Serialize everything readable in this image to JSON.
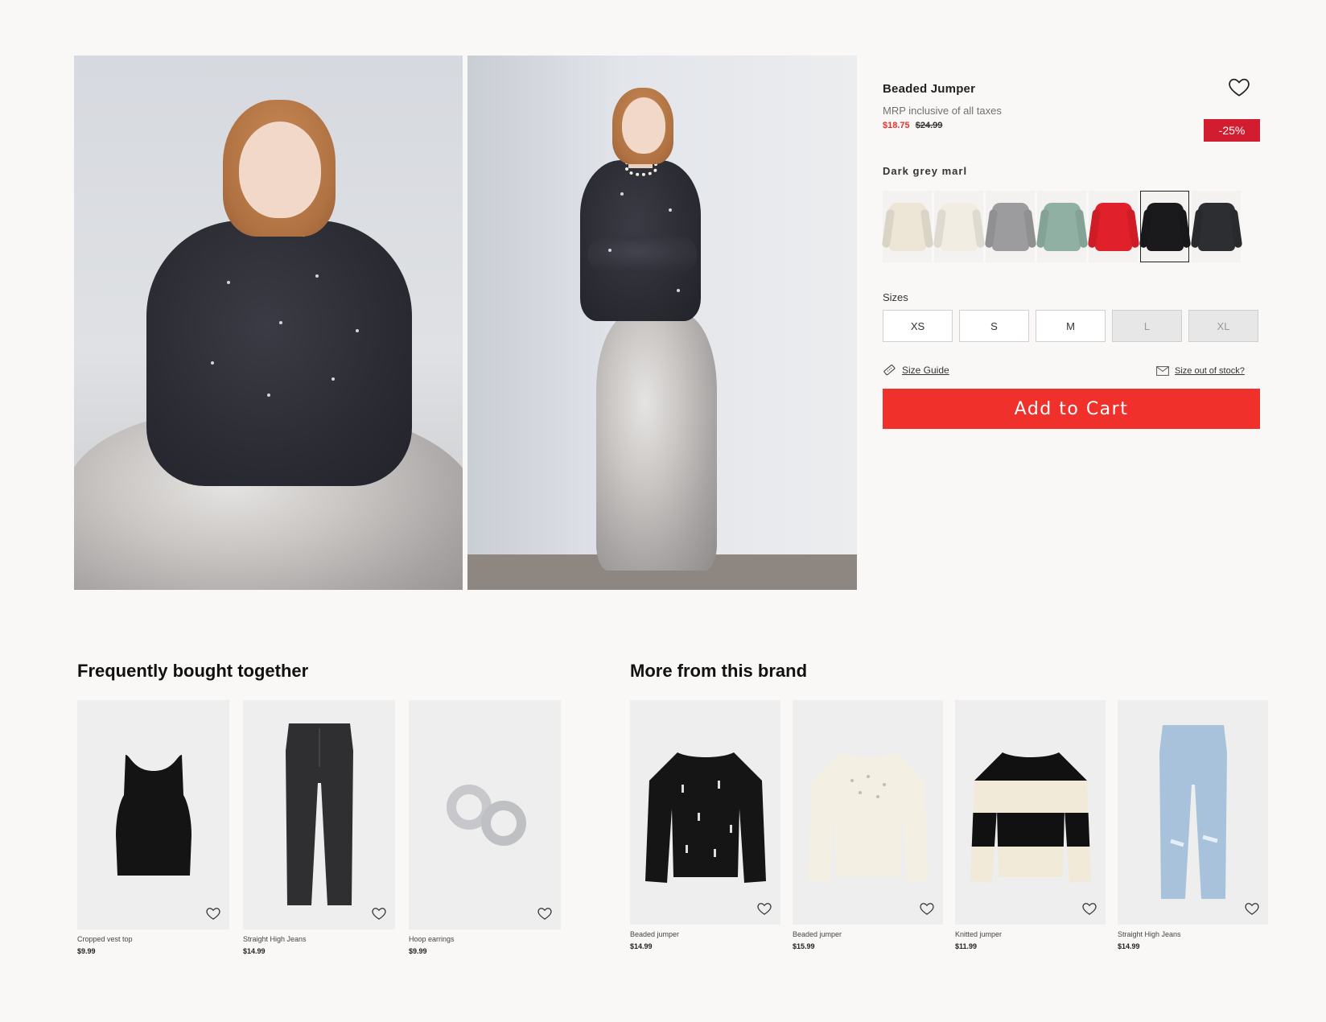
{
  "product": {
    "title": "Beaded Jumper",
    "mrp_note": "MRP inclusive of all taxes",
    "price": "$18.75",
    "old_price": "$24.99",
    "discount": "-25%",
    "color_name": "Dark grey marl",
    "swatches": [
      {
        "color": "#ede6d7"
      },
      {
        "color": "#f1ede3"
      },
      {
        "color": "#9c9c9e"
      },
      {
        "color": "#8fb0a3"
      },
      {
        "color": "#e0202a"
      },
      {
        "color": "#1a1a1d"
      },
      {
        "color": "#2d2e31"
      }
    ],
    "selected_swatch": 5,
    "sizes_label": "Sizes",
    "sizes": [
      "XS",
      "S",
      "M",
      "L",
      "XL"
    ],
    "size_guide": "Size Guide",
    "size_out_of_stock": "Size out of stock?",
    "add_to_cart": "Add to Cart"
  },
  "frequently_bought": {
    "title": "Frequently bought together",
    "items": [
      {
        "name": "Cropped vest top",
        "price": "$9.99"
      },
      {
        "name": "Straight High Jeans",
        "price": "$14.99"
      },
      {
        "name": "Hoop earrings",
        "price": "$9.99"
      }
    ]
  },
  "more_brand": {
    "title": "More from this brand",
    "items": [
      {
        "name": "Beaded jumper",
        "price": "$14.99"
      },
      {
        "name": "Beaded jumper",
        "price": "$15.99"
      },
      {
        "name": "Knitted jumper",
        "price": "$11.99"
      },
      {
        "name": "Straight High Jeans",
        "price": "$14.99"
      }
    ]
  },
  "colors": {
    "accent": "#f0312b",
    "discount_badge": "#d21d31",
    "sale_price": "#e1332c"
  }
}
